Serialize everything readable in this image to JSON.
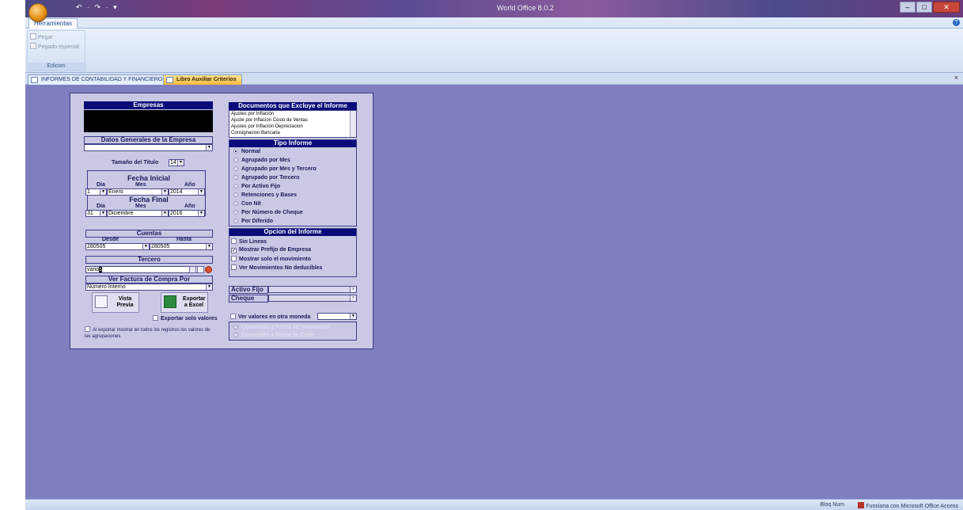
{
  "window": {
    "app_title": "World Office 8.0.2",
    "qat": "↶ · ↷ · ▾",
    "min": "–",
    "max": "□",
    "close": "✕"
  },
  "ribbon": {
    "tab": "Herramientas",
    "help": "?",
    "items": [
      "Pegar",
      "Pegado especial"
    ],
    "group_label": "Edicion"
  },
  "doc_tabs": {
    "informes": "INFORMES DE CONTABILIDAD Y FINANCIEROS",
    "libro": "Libro Auxiliar Criterios",
    "close": "×"
  },
  "form": {
    "empresas_header": "Empresas",
    "datos_generales_header": "Datos Generales de la Empresa",
    "tamano_label": "Tamaño del Titulo",
    "tamano_value": "14",
    "fecha_inicial_header": "Fecha Inicial",
    "fecha_final_header": "Fecha Final",
    "dia_label": "Dia",
    "mes_label": "Mes",
    "anio_label": "Año",
    "fi_dia": "1",
    "fi_mes": "Enero",
    "fi_anio": "2014",
    "ff_dia": "31",
    "ff_mes": "Diciembre",
    "ff_anio": "2016",
    "cuentas_header": "Cuentas",
    "desde_label": "Desde",
    "hasta_label": "Hasta",
    "desde_value": "280505",
    "hasta_value": "280505",
    "tercero_header": "Tercero",
    "tercero_value_a": "vario",
    "tercero_value_b": "s",
    "factura_header": "Ver Factura de Compra Por",
    "factura_value": "Número Interno",
    "vista_previa": "Vista Previa",
    "exportar_excel": "Exportar a Excel",
    "exportar_solo_valores": "Exportar solo valores",
    "al_exportar": "Al exportar mostrar en todos los registros los valores de las agrupaciones",
    "documentos_header": "Documentos que Excluye el Informe",
    "documentos": [
      "Ajustes por Inflación",
      "Ajuste por Inflación Costo de Ventas",
      "Ajustes por Inflación Depreciacion",
      "Consignacion Bancaria"
    ],
    "tipo_informe_header": "Tipo Informe",
    "tipo_informe": [
      "Normal",
      "Agrupado por Mes",
      "Agrupado por Mes y Tercero",
      "Agrupado por Tercero",
      "Por Activo Fijo",
      "Retenciones y Bases",
      "Con Nit",
      "Por Número de Cheque",
      "Por Diferido"
    ],
    "opcion_header": "Opcion del Informe",
    "opciones": [
      "Sin Lineas",
      "Mostrar Prefijo de Empresa",
      "Mostrar solo el movimiento",
      "Ver Movimientos No deducibles"
    ],
    "activo_fijo_label": "Activo Fijo",
    "cheque_label": "Cheque",
    "ver_valores_label": "Ver valores en otra moneda",
    "conversion_1": "Conversión a Fecha del movimiento",
    "conversion_2": "Conversión a Fecha de Corte"
  },
  "status": {
    "bloq": "Bloq Num",
    "access": "Funciona con Microsoft Office Access"
  },
  "colors": {
    "workspace": "#7f7fbf",
    "form_bg": "#c9c9e5",
    "header_navy": "#0a0a78"
  }
}
